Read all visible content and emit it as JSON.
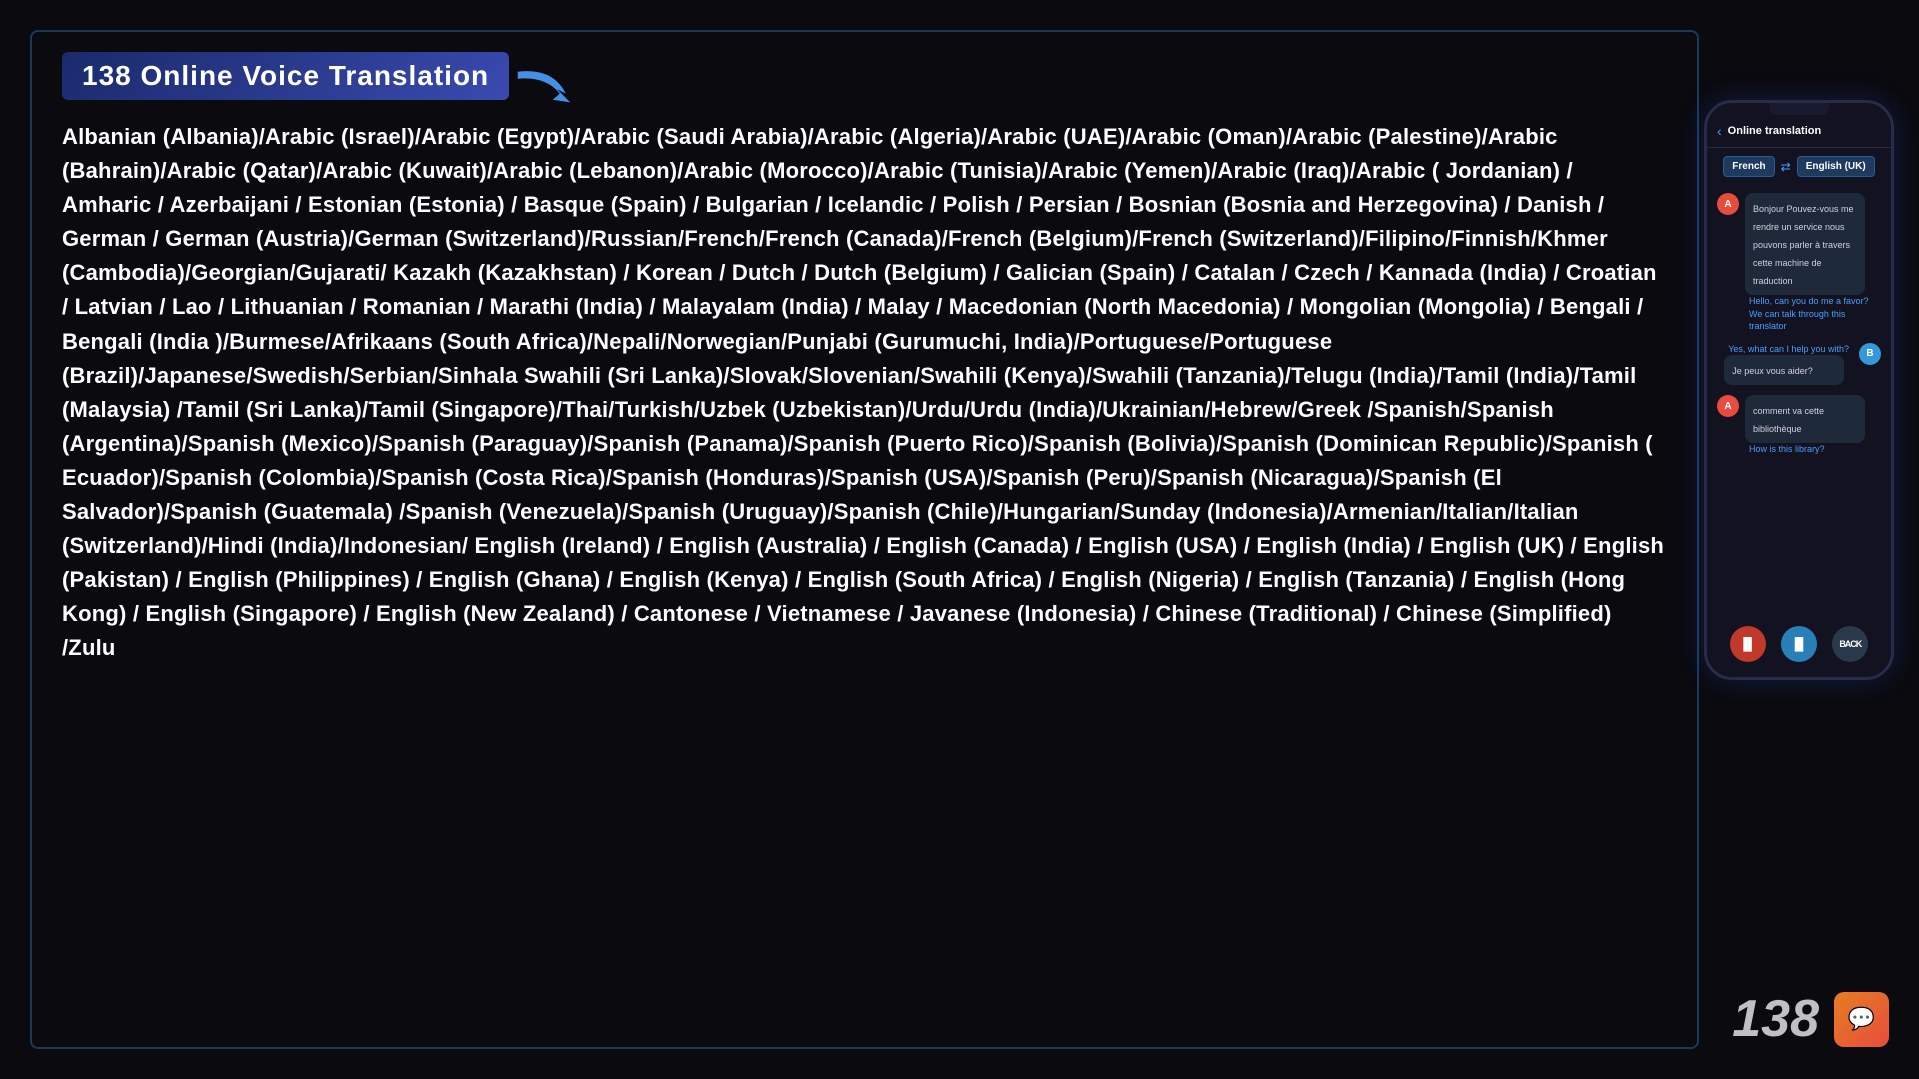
{
  "title": "138 Online Voice Translation",
  "languages_text": "Albanian (Albania)/Arabic (Israel)/Arabic (Egypt)/Arabic (Saudi Arabia)/Arabic (Algeria)/Arabic (UAE)/Arabic (Oman)/Arabic (Palestine)/Arabic (Bahrain)/Arabic (Qatar)/Arabic (Kuwait)/Arabic (Lebanon)/Arabic (Morocco)/Arabic (Tunisia)/Arabic (Yemen)/Arabic (Iraq)/Arabic ( Jordanian) / Amharic / Azerbaijani / Estonian (Estonia) / Basque (Spain) / Bulgarian / Icelandic / Polish / Persian / Bosnian (Bosnia and Herzegovina) / Danish / German / German (Austria)/German (Switzerland)/Russian/French/French (Canada)/French (Belgium)/French (Switzerland)/Filipino/Finnish/Khmer (Cambodia)/Georgian/Gujarati/ Kazakh (Kazakhstan) / Korean / Dutch / Dutch (Belgium) / Galician (Spain) / Catalan / Czech / Kannada (India) / Croatian / Latvian / Lao / Lithuanian / Romanian / Marathi (India) / Malayalam (India) / Malay / Macedonian (North Macedonia) / Mongolian (Mongolia) / Bengali / Bengali (India )/Burmese/Afrikaans (South Africa)/Nepali/Norwegian/Punjabi (Gurumuchi, India)/Portuguese/Portuguese (Brazil)/Japanese/Swedish/Serbian/Sinhala Swahili (Sri Lanka)/Slovak/Slovenian/Swahili (Kenya)/Swahili (Tanzania)/Telugu (India)/Tamil (India)/Tamil (Malaysia) /Tamil (Sri Lanka)/Tamil (Singapore)/Thai/Turkish/Uzbek (Uzbekistan)/Urdu/Urdu (India)/Ukrainian/Hebrew/Greek /Spanish/Spanish (Argentina)/Spanish (Mexico)/Spanish (Paraguay)/Spanish (Panama)/Spanish (Puerto Rico)/Spanish (Bolivia)/Spanish (Dominican Republic)/Spanish ( Ecuador)/Spanish (Colombia)/Spanish (Costa Rica)/Spanish (Honduras)/Spanish (USA)/Spanish (Peru)/Spanish (Nicaragua)/Spanish (El Salvador)/Spanish (Guatemala) /Spanish (Venezuela)/Spanish (Uruguay)/Spanish (Chile)/Hungarian/Sunday (Indonesia)/Armenian/Italian/Italian (Switzerland)/Hindi (India)/Indonesian/ English (Ireland) / English (Australia) / English (Canada) / English (USA) / English (India) / English (UK) / English (Pakistan) / English (Philippines) / English (Ghana) / English (Kenya) / English (South Africa) / English (Nigeria) / English (Tanzania) / English (Hong Kong) / English (Singapore) / English (New Zealand) / Cantonese / Vietnamese / Javanese (Indonesia) / Chinese (Traditional) / Chinese (Simplified) /Zulu",
  "phone": {
    "header": {
      "back_label": "‹",
      "title": "Online translation"
    },
    "lang_from": "French",
    "lang_to": "English (UK)",
    "swap_icon": "⇄",
    "messages": [
      {
        "side": "left",
        "avatar": "A",
        "text": "Bonjour Pouvez-vous me rendre un service nous pouvons parler à travers cette machine de traduction",
        "translated": "Hello, can you do me a favor? We can talk through this translator"
      },
      {
        "side": "right",
        "avatar": "B",
        "text": "Yes, what can I help you with?",
        "translated": "Je peux vous aider?"
      },
      {
        "side": "left",
        "avatar": "A",
        "text": "comment va cette bibliothèque",
        "translated": "How is this library?"
      }
    ],
    "controls": [
      {
        "id": "mic-a",
        "color": "red",
        "icon": "🎙"
      },
      {
        "id": "mic-b",
        "color": "blue",
        "icon": "📊"
      },
      {
        "id": "back",
        "color": "gray",
        "icon": "↩"
      }
    ]
  },
  "branding": {
    "number": "138",
    "icon": "💬"
  }
}
